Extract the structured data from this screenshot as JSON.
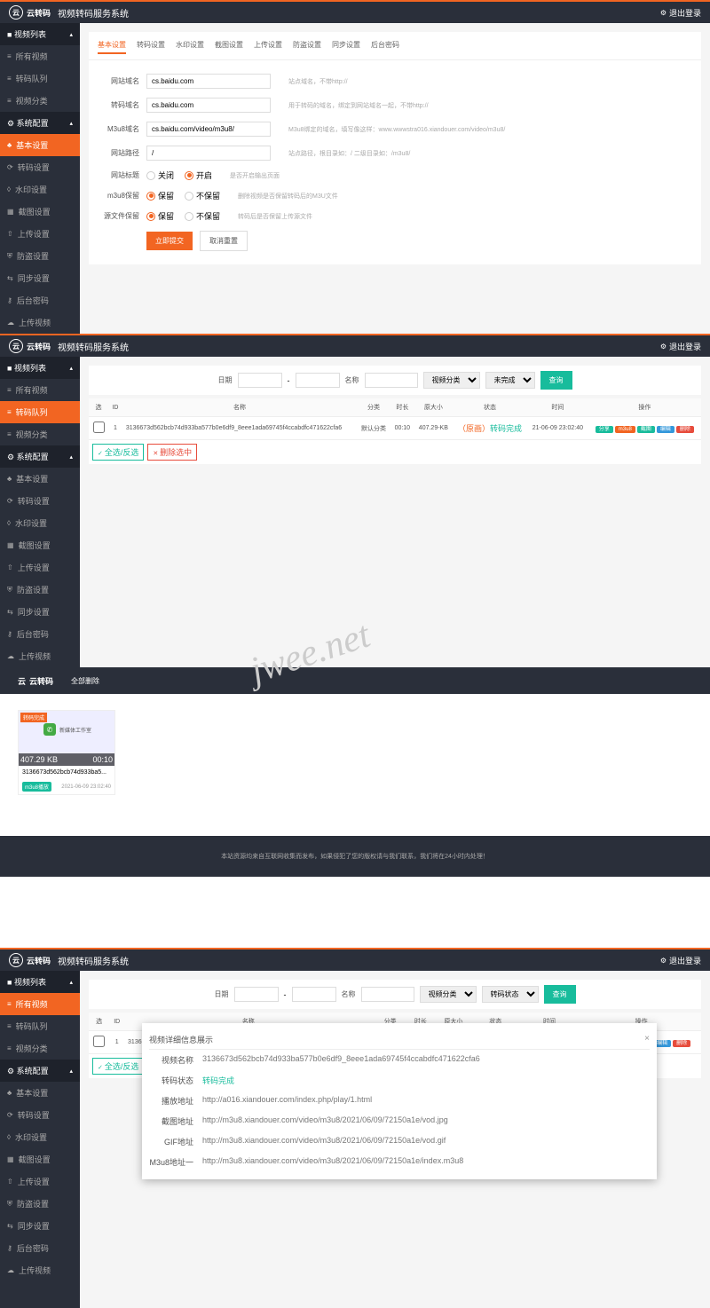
{
  "header": {
    "brand": "云转码",
    "title": "视频转码服务系统",
    "logout": "退出登录"
  },
  "sidebar": {
    "group1": "视频列表",
    "items1": [
      "所有视频",
      "转码队列",
      "视频分类"
    ],
    "group2": "系统配置",
    "items2": [
      "基本设置",
      "转码设置",
      "水印设置",
      "截图设置",
      "上传设置",
      "防盗设置",
      "同步设置",
      "后台密码",
      "上传视频"
    ]
  },
  "panel1": {
    "tabs": [
      "基本设置",
      "转码设置",
      "水印设置",
      "截图设置",
      "上传设置",
      "防盗设置",
      "同步设置",
      "后台密码"
    ],
    "rows": {
      "domain": {
        "label": "网站域名",
        "value": "cs.baidu.com",
        "hint": "站点域名，不带http://"
      },
      "transcode": {
        "label": "转码域名",
        "value": "cs.baidu.com",
        "hint": "用于转码的域名，绑定到网站域名一起，不带http://"
      },
      "m3u8": {
        "label": "M3u8域名",
        "value": "cs.baidu.com/video/m3u8/",
        "hint": "M3u8绑定的域名，填写像这样：www.wwwstra016.xiandouer.com/video/m3u8/"
      },
      "path": {
        "label": "网站路径",
        "value": "/",
        "hint": "站点路径，根目录如：/ 二级目录如：/m3u8/"
      },
      "title": {
        "label": "网站标题",
        "opt1": "关闭",
        "opt2": "开启",
        "hint": "是否开启输出页面"
      },
      "m3u8keep": {
        "label": "m3u8保留",
        "opt1": "保留",
        "opt2": "不保留",
        "hint": "删除视频是否保留转码后的M3U文件"
      },
      "srckeep": {
        "label": "源文件保留",
        "opt1": "保留",
        "opt2": "不保留",
        "hint": "转码后是否保留上传源文件"
      }
    },
    "btn_save": "立即提交",
    "btn_reset": "取消重置"
  },
  "panel2": {
    "filter": {
      "date_label": "日期",
      "name_label": "名称",
      "cat": "视频分类",
      "status": "未完成",
      "query": "查询"
    },
    "thead": [
      "选",
      "ID",
      "名称",
      "分类",
      "时长",
      "原大小",
      "状态",
      "时间",
      "操作"
    ],
    "row": {
      "id": "1",
      "name": "3136673d562bcb74d933ba577b0e6df9_8eee1ada69745f4ccabdfc471622cfa6",
      "cat": "默认分类",
      "dur": "00:10",
      "size": "407.29-KB",
      "status_pre": "（原画）",
      "status": "转码完成",
      "time": "21-06-09 23:02:40"
    },
    "ops": [
      "分享",
      "m3u8",
      "截图",
      "编辑",
      "删除"
    ],
    "select_all": "全选/反选",
    "delete_sel": "删除选中"
  },
  "panel3": {
    "delete_all": "全部删除",
    "card": {
      "tag": "转码完成",
      "size": "407.29 KB",
      "mid": "新媒体工作室",
      "dur": "00:10",
      "name": "3136673d562bcb74d933ba5...",
      "m3u8": "m3u8播放",
      "date": "2021-06-09 23:02:40"
    },
    "footer": "本站资源均来自互联网收集而发布，如果侵犯了您的版权请与我们联系，我们将在24小时内处理！"
  },
  "panel4": {
    "filter_status": "转码状态",
    "modal": {
      "title": "视频详细信息展示",
      "rows": {
        "name": {
          "label": "视频名称",
          "val": "3136673d562bcb74d933ba577b0e6df9_8eee1ada69745f4ccabdfc471622cfa6"
        },
        "status": {
          "label": "转码状态",
          "val": "转码完成"
        },
        "play": {
          "label": "播放地址",
          "val": "http://a016.xiandouer.com/index.php/play/1.html"
        },
        "shot": {
          "label": "截图地址",
          "val": "http://m3u8.xiandouer.com/video/m3u8/2021/06/09/72150a1e/vod.jpg"
        },
        "gif": {
          "label": "GIF地址",
          "val": "http://m3u8.xiandouer.com/video/m3u8/2021/06/09/72150a1e/vod.gif"
        },
        "m3u8": {
          "label": "M3u8地址一",
          "val": "http://m3u8.xiandouer.com/video/m3u8/2021/06/09/72150a1e/index.m3u8"
        }
      }
    }
  },
  "watermark": "jwee.net"
}
